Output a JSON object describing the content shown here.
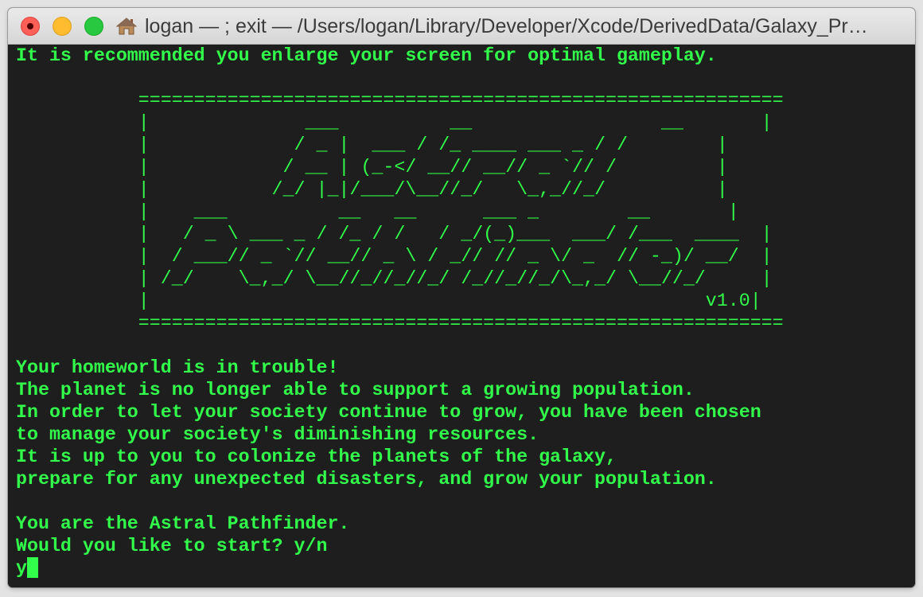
{
  "window": {
    "title": "logan — ; exit — /Users/logan/Library/Developer/Xcode/DerivedData/Galaxy_Pr…",
    "title_icon": "home-icon"
  },
  "colors": {
    "terminal_text": "#31fd4a",
    "terminal_bg": "#1e1e1e"
  },
  "terminal": {
    "notice": "It is recommended you enlarge your screen for optimal gameplay.",
    "banner": [
      "           ==========================================================",
      "           |              ___          __                 __       |",
      "           |             / _ |  ___ / /_ ____ ___ _ / /        |",
      "           |            / __ | (_-</ __// __// _ `// /         |",
      "           |           /_/ |_|/___/\\__//_/   \\_,_//_/          |",
      "           |    ___          __   __      ___ _        __       |",
      "           |   / _ \\ ___ _ / /_ / /   / _/(_)___  ___/ /___  ____  |",
      "           |  / ___// _ `// __// _ \\ / _// // _ \\/ _  // -_)/ __/  |",
      "           | /_/    \\_,_/ \\__//_//_//_/ /_//_//_/\\_,_/ \\__//_/     |",
      "           |                                                  v1.0|",
      "           =========================================================="
    ],
    "story": [
      "Your homeworld is in trouble!",
      "The planet is no longer able to support a growing population.",
      "In order to let your society continue to grow, you have been chosen",
      "to manage your society's diminishing resources.",
      "It is up to you to colonize the planets of the galaxy,",
      "prepare for any unexpected disasters, and grow your population."
    ],
    "closing": [
      "You are the Astral Pathfinder.",
      "Would you like to start? y/n"
    ],
    "input_value": "y"
  }
}
